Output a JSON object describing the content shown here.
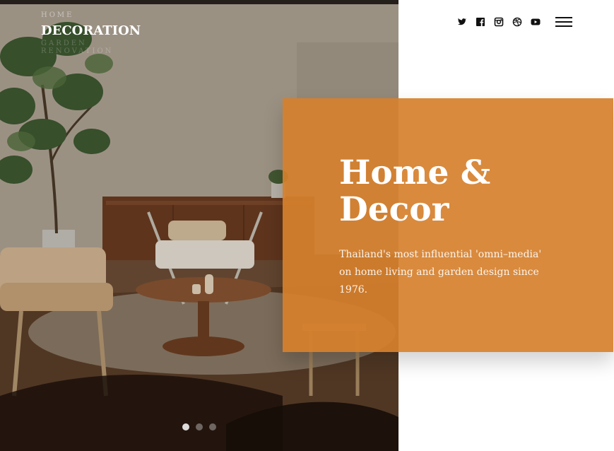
{
  "nav": {
    "items": [
      {
        "label": "HOME",
        "state": "inactive"
      },
      {
        "label": "DECORATION",
        "state": "active"
      },
      {
        "label": "GARDEN",
        "state": "faint"
      },
      {
        "label": "RENOVATION",
        "state": "faint"
      }
    ]
  },
  "social": {
    "icons": [
      "twitter-icon",
      "facebook-icon",
      "instagram-icon",
      "dribbble-icon",
      "youtube-icon"
    ]
  },
  "menu": {
    "icon": "hamburger-menu-icon"
  },
  "feature": {
    "title": "Home &\nDecor",
    "description": "Thailand's most influential 'omni–media' on home living and garden design since 1976.",
    "background_color": "#d6802d"
  },
  "slider": {
    "count": 3,
    "active_index": 0
  }
}
